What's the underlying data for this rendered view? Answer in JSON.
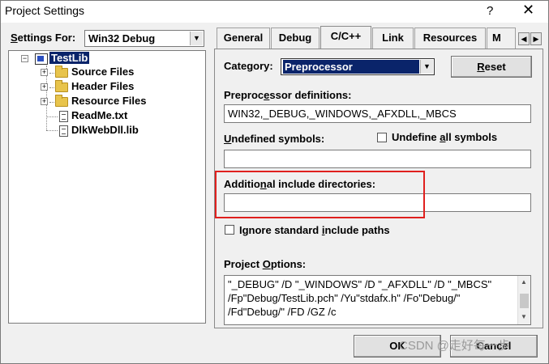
{
  "window": {
    "title": "Project Settings",
    "help_glyph": "?",
    "close_glyph": "✕"
  },
  "left": {
    "settings_for_label": "Settings For:",
    "settings_for_value": "Win32 Debug",
    "tree": {
      "root": "TestLib",
      "children": [
        {
          "label": "Source Files",
          "type": "folder"
        },
        {
          "label": "Header Files",
          "type": "folder"
        },
        {
          "label": "Resource Files",
          "type": "folder"
        },
        {
          "label": "ReadMe.txt",
          "type": "file"
        },
        {
          "label": "DlkWebDll.lib",
          "type": "file"
        }
      ],
      "expand_glyph": "+",
      "collapse_glyph": "−"
    }
  },
  "tabs": [
    "General",
    "Debug",
    "C/C++",
    "Link",
    "Resources",
    "M"
  ],
  "active_tab": "C/C++",
  "tab_scroll": {
    "left": "◀",
    "right": "▶"
  },
  "cc": {
    "category_label": "Category:",
    "category_value": "Preprocessor",
    "reset_label": "Reset",
    "preprocessor_label": "Preprocessor definitions:",
    "preprocessor_value": "WIN32,_DEBUG,_WINDOWS,_AFXDLL,_MBCS",
    "undefined_label": "Undefined symbols:",
    "undefined_value": "",
    "undefine_all_label": "Undefine all symbols",
    "undefine_all_checked": false,
    "include_label": "Additional include directories:",
    "include_value": "",
    "ignore_label": "Ignore standard include paths",
    "ignore_checked": false,
    "options_label": "Project Options:",
    "options_lines": [
      "\"_DEBUG\" /D \"_WINDOWS\" /D \"_AFXDLL\" /D \"_MBCS\"",
      "/Fp\"Debug/TestLib.pch\" /Yu\"stdafx.h\" /Fo\"Debug/\"",
      "/Fd\"Debug/\" /FD /GZ   /c"
    ]
  },
  "buttons": {
    "ok": "OK",
    "cancel": "Cancel"
  },
  "watermark": "CSDN @走好每一步",
  "colors": {
    "highlight": "#0a246a",
    "annotation_red": "#e0201e"
  }
}
